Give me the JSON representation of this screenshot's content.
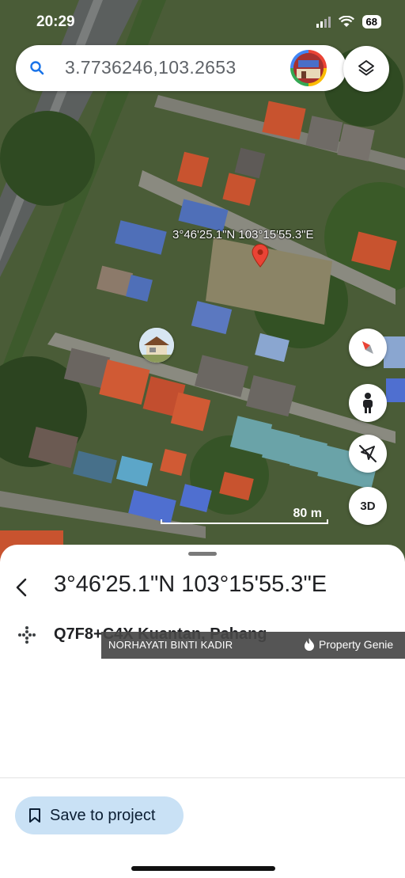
{
  "status": {
    "time": "20:29",
    "battery": "68"
  },
  "search": {
    "query": "3.7736246,103.2653"
  },
  "map": {
    "pin_coordinates": "3°46'25.1\"N 103°15'55.3\"E",
    "scale_label": "80 m",
    "controls": {
      "three_d_label": "3D"
    }
  },
  "place": {
    "title": "3°46'25.1\"N 103°15'55.3\"E",
    "plus_code": "Q7F8+C4X Kuantan, Pahang"
  },
  "watermark": {
    "name": "NORHAYATI BINTI KADIR",
    "brand": "Property Genie"
  },
  "actions": {
    "save_label": "Save to project"
  },
  "colors": {
    "accent": "#1a73e8",
    "save_button_bg": "#c9e1f5",
    "pin": "#ea4335",
    "compass_red": "#ea4335"
  },
  "icons": [
    "search-icon",
    "layers-icon",
    "compass-icon",
    "pegman-icon",
    "location-off-icon",
    "back-arrow-icon",
    "plus-code-icon",
    "bookmark-icon",
    "flame-icon"
  ]
}
